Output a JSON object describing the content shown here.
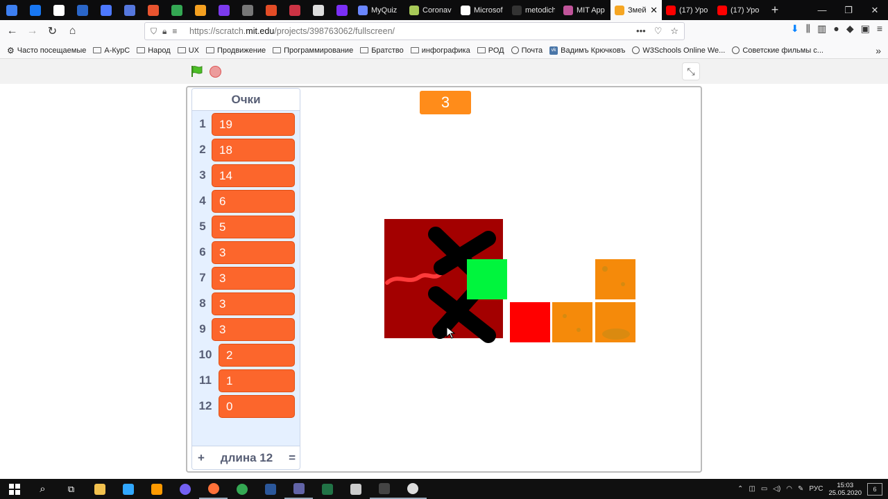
{
  "browser": {
    "pinned_colors": [
      "#3d7ff0",
      "#1877f2",
      "#ffffff",
      "#2a66c9",
      "#4d79ff",
      "#5577dd",
      "#e8542f",
      "#34a853",
      "#f4a020",
      "#7c3aed",
      "#777777",
      "#e34c26",
      "#cc3344",
      "#dddddd",
      "#7b2ff7"
    ],
    "tabs": [
      {
        "title": "MyQuiz",
        "color": "#6a86ff",
        "active": false
      },
      {
        "title": "Coronav",
        "color": "#a7c957",
        "active": false
      },
      {
        "title": "Microsof",
        "color": "#ffffff",
        "active": false
      },
      {
        "title": "metodichka_",
        "color": "#333333",
        "active": false
      },
      {
        "title": "MIT App",
        "color": "#c0549a",
        "active": false
      },
      {
        "title": "Змей",
        "color": "#f6a623",
        "active": true
      },
      {
        "title": "(17) Уро",
        "color": "#ff0000",
        "active": false
      },
      {
        "title": "(17) Уро",
        "color": "#ff0000",
        "active": false
      }
    ],
    "url_prefix": "https://scratch.",
    "url_domain": "mit.edu",
    "url_path": "/projects/398763062/fullscreen/",
    "bookmarks": [
      {
        "label": "Часто посещаемые",
        "icon": "gear-icon"
      },
      {
        "label": "А-КурС",
        "icon": "folder-icon"
      },
      {
        "label": "Народ",
        "icon": "folder-icon"
      },
      {
        "label": "UX",
        "icon": "folder-icon"
      },
      {
        "label": "Продвижение",
        "icon": "folder-icon"
      },
      {
        "label": "Программирование",
        "icon": "folder-icon"
      },
      {
        "label": "Братство",
        "icon": "folder-icon"
      },
      {
        "label": "инфографика",
        "icon": "folder-icon"
      },
      {
        "label": "РОД",
        "icon": "folder-icon"
      },
      {
        "label": "Почта",
        "icon": "globe-icon"
      },
      {
        "label": "Вадимъ Крючковъ",
        "icon": "vk-icon"
      },
      {
        "label": "W3Schools Online We...",
        "icon": "globe-icon"
      },
      {
        "label": "Советские фильмы с...",
        "icon": "globe-icon"
      }
    ]
  },
  "scratch": {
    "score_value": "3",
    "list": {
      "title": "Очки",
      "items": [
        {
          "index": "1",
          "value": "19"
        },
        {
          "index": "2",
          "value": "18"
        },
        {
          "index": "3",
          "value": "14"
        },
        {
          "index": "4",
          "value": "6"
        },
        {
          "index": "5",
          "value": "5"
        },
        {
          "index": "6",
          "value": "3"
        },
        {
          "index": "7",
          "value": "3"
        },
        {
          "index": "8",
          "value": "3"
        },
        {
          "index": "9",
          "value": "3"
        },
        {
          "index": "10",
          "value": "2"
        },
        {
          "index": "11",
          "value": "1"
        },
        {
          "index": "12",
          "value": "0"
        }
      ],
      "footer_add": "+",
      "footer_length": "длина 12",
      "footer_eq": "="
    }
  },
  "taskbar": {
    "apps": [
      {
        "name": "explorer",
        "color": "#f2c14e"
      },
      {
        "name": "photoshop",
        "color": "#31a8ff"
      },
      {
        "name": "illustrator",
        "color": "#ff9a00"
      },
      {
        "name": "viber",
        "color": "#7360f2"
      },
      {
        "name": "firefox",
        "color": "#ff7139"
      },
      {
        "name": "chrome",
        "color": "#34a853"
      },
      {
        "name": "word",
        "color": "#2b579a"
      },
      {
        "name": "teams",
        "color": "#6264a7"
      },
      {
        "name": "excel",
        "color": "#217346"
      },
      {
        "name": "settings",
        "color": "#cccccc"
      },
      {
        "name": "calculator",
        "color": "#444444"
      },
      {
        "name": "obs",
        "color": "#dddddd"
      }
    ],
    "lang": "РУС",
    "time": "15:03",
    "date": "25.05.2020",
    "notifications": "6"
  }
}
